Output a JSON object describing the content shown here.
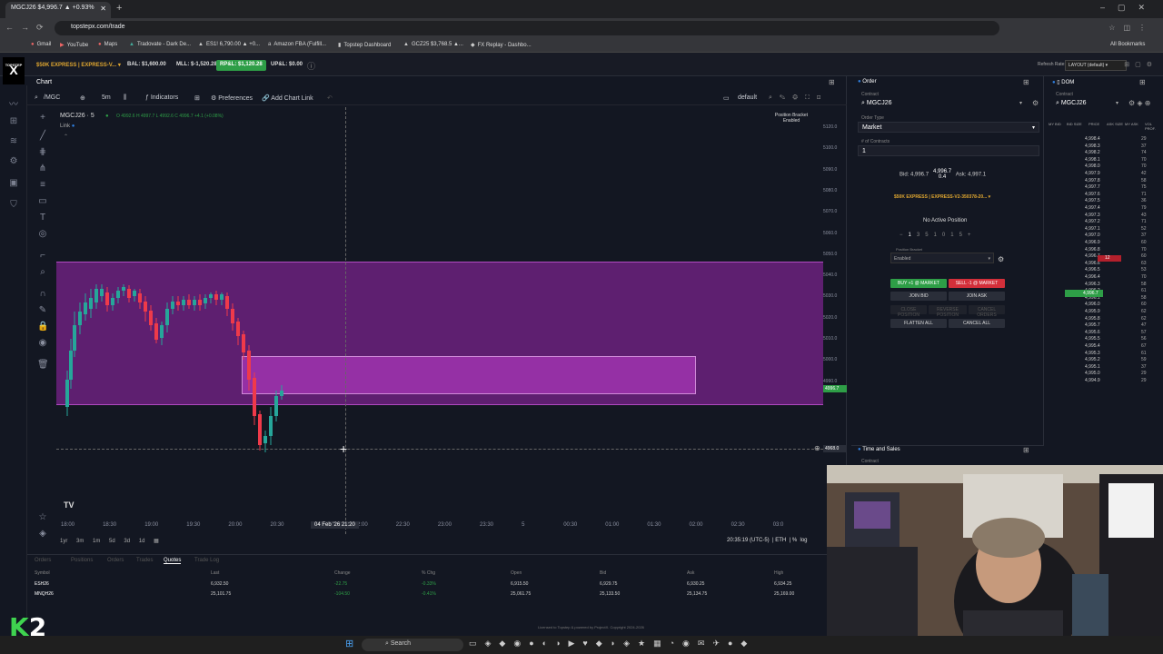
{
  "browser": {
    "tab_title": "MGCJ26 $4,996.7 ▲ +0.93%",
    "url": "topstepx.com/trade",
    "bookmarks": [
      "Gmail",
      "YouTube",
      "Maps",
      "Tradovate - Dark De...",
      "ES1! 6,790.00 ▲ +0...",
      "Amazon FBA (Fulfill...",
      "Topstep Dashboard",
      "GCZ25 $3,768.5 ▲...",
      "FX Replay - Dashbo..."
    ],
    "all_bookmarks": "All Bookmarks"
  },
  "header": {
    "logo": "X",
    "logo_small": "TOPSTEP",
    "account": "$50K EXPRESS | EXPRESS-V... ▾",
    "balance": "BAL: $1,600.00",
    "mll": "MLL: $-1,520.28",
    "rpl": "RP&L: $1,120.28",
    "upl": "UP&L: $0.00",
    "refresh": "Refresh Rate: Medium",
    "layout": "LAYOUT (default) ▾"
  },
  "chart": {
    "tab": "Chart",
    "symbol_input": "/MGC",
    "interval": "5m",
    "indicators": "Indicators",
    "preferences": "Preferences",
    "add_chart_link": "Add Chart Link",
    "template": "default",
    "symbol_label": "MGCJ26 · 5",
    "ohlc": "O 4992.6  H 4997.7  L 4992.6  C 4996.7  +4.1 (+0.08%)",
    "link_label": "Link",
    "position_bracket": "Position Bracket",
    "position_bracket_state": "Enabled",
    "price_ticks": [
      "5120.0",
      "5100.0",
      "5090.0",
      "5080.0",
      "5070.0",
      "5060.0",
      "5050.0",
      "5040.0",
      "5030.0",
      "5020.0",
      "5010.0",
      "5000.0",
      "4990.0"
    ],
    "current_price": "4996.7",
    "hover_price": "4968.0",
    "time_ticks": [
      "18:00",
      "18:30",
      "19:00",
      "19:30",
      "20:00",
      "20:30",
      "21:0",
      "22:00",
      "22:30",
      "23:00",
      "23:30",
      "5",
      "00:30",
      "01:00",
      "01:30",
      "02:00",
      "02:30",
      "03:0"
    ],
    "time_hover": "04 Feb '26  21:20",
    "timeframes": [
      "1yr",
      "3m",
      "1m",
      "5d",
      "3d",
      "1d"
    ],
    "clock": "20:35:19 (UTC-5)",
    "session": "ETH",
    "pct": "%",
    "log": "log"
  },
  "quotes": {
    "tabs": [
      "Orders",
      "Positions",
      "Orders",
      "Trades",
      "Quotes",
      "Trade Log"
    ],
    "active_tab": "Quotes",
    "columns": [
      "Symbol",
      "Last",
      "Change",
      "% Chg",
      "Open",
      "Bid",
      "Ask",
      "High"
    ],
    "rows": [
      [
        "ESH26",
        "6,932.50",
        "-22.75",
        "-0.33%",
        "6,915.50",
        "6,929.75",
        "6,930.25",
        "6,934.25"
      ],
      [
        "MNQH26",
        "25,101.75",
        "-104.50",
        "-0.41%",
        "25,061.75",
        "25,133.50",
        "25,134.75",
        "25,169.00"
      ]
    ],
    "footnote": "Licensed to Topstep & powered by ProjectX. Copyright 2024-2026"
  },
  "order": {
    "title": "Order",
    "contract_label": "Contract",
    "contract": "MGCJ26",
    "order_type_label": "Order Type",
    "order_type": "Market",
    "contracts_label": "# of Contracts",
    "contracts": "1",
    "bid": "Bid: 4,996.7",
    "last": "4,996.7",
    "spread": "0.4",
    "ask": "Ask: 4,997.1",
    "account": "$50K EXPRESS | EXPRESS-V2-350378-20... ▾",
    "no_position": "No Active Position",
    "qty_buttons": [
      "−",
      "1",
      "3",
      "5",
      "10",
      "15",
      "+"
    ],
    "pb_label": "Position Bracket",
    "pb_value": "Enabled",
    "buy": "BUY +1 @ MARKET",
    "sell": "SELL -1 @ MARKET",
    "join_bid": "JOIN BID",
    "join_ask": "JOIN ASK",
    "close_position": "CLOSE POSITION",
    "reverse_position": "REVERSE POSITION",
    "cancel_orders": "CANCEL ORDERS",
    "flatten_all": "FLATTEN ALL",
    "cancel_all": "CANCEL ALL",
    "time_and_sales": "Time and Sales",
    "tns_contract": "Contract"
  },
  "dom": {
    "title": "DOM",
    "contract_label": "Contract",
    "contract": "MGCJ26",
    "columns": [
      "MY BID",
      "BID SIZE",
      "PRICE",
      "ASK SIZE",
      "MY ASK",
      "VOL PROF."
    ],
    "rows": [
      [
        "4,998.4",
        "29"
      ],
      [
        "4,998.3",
        "37"
      ],
      [
        "4,998.2",
        "74"
      ],
      [
        "4,998.1",
        "70"
      ],
      [
        "4,998.0",
        "70"
      ],
      [
        "4,997.9",
        "42"
      ],
      [
        "4,997.8",
        "58"
      ],
      [
        "4,997.7",
        "75"
      ],
      [
        "4,997.6",
        "71"
      ],
      [
        "4,997.5",
        "36"
      ],
      [
        "4,997.4",
        "79"
      ],
      [
        "4,997.3",
        "43"
      ],
      [
        "4,997.2",
        "71"
      ],
      [
        "4,997.1",
        "52"
      ],
      [
        "4,997.0",
        "37"
      ],
      [
        "4,996.9",
        "60"
      ],
      [
        "4,996.8",
        "70"
      ],
      [
        "4,996.7",
        "60"
      ],
      [
        "4,996.6",
        "63"
      ],
      [
        "4,996.5",
        "53"
      ],
      [
        "4,996.4",
        "70"
      ],
      [
        "4,996.3",
        "58"
      ],
      [
        "4,996.2",
        "61"
      ],
      [
        "4,996.1",
        "58"
      ],
      [
        "4,996.0",
        "60"
      ],
      [
        "4,995.9",
        "62"
      ],
      [
        "4,995.8",
        "62"
      ],
      [
        "4,995.7",
        "47"
      ],
      [
        "4,995.6",
        "57"
      ],
      [
        "4,995.5",
        "56"
      ],
      [
        "4,995.4",
        "67"
      ],
      [
        "4,995.3",
        "61"
      ],
      [
        "4,995.2",
        "59"
      ],
      [
        "4,995.1",
        "37"
      ],
      [
        "4,995.0",
        "29"
      ],
      [
        "4,994.9",
        "29"
      ]
    ],
    "ask_size_highlight": "12",
    "bid_size_highlight": "4,996.7"
  },
  "taskbar": {
    "search": "Search"
  },
  "overlay": {
    "logo_k": "K",
    "logo_2": "2"
  }
}
